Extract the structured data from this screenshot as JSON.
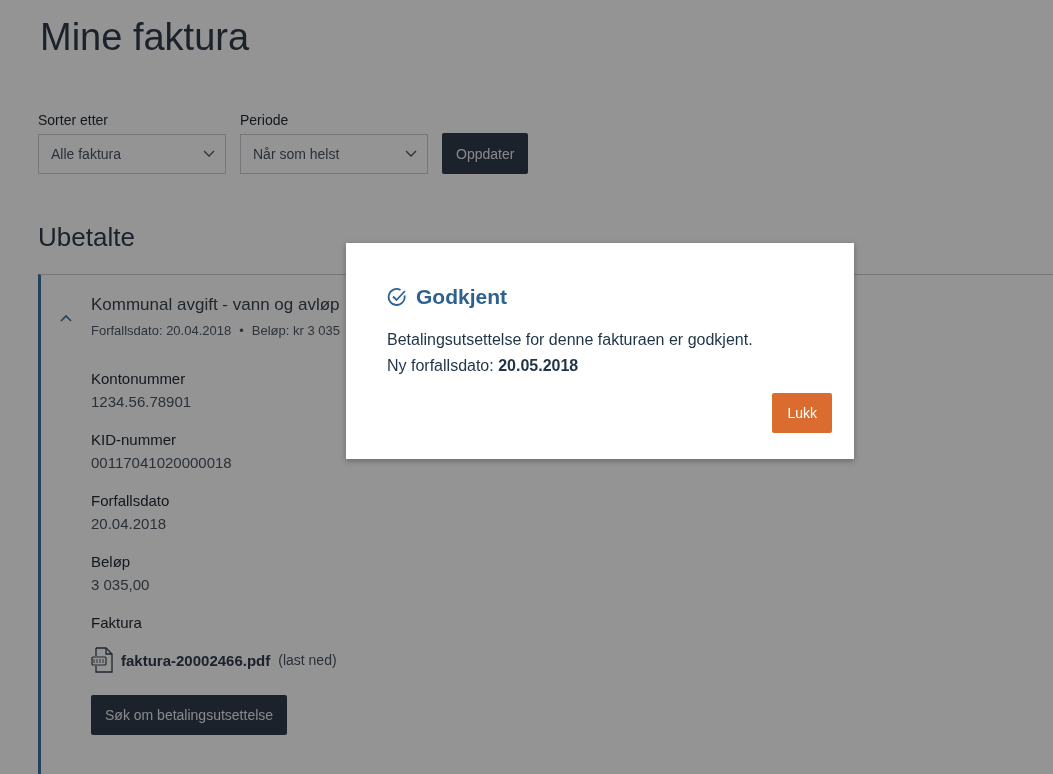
{
  "page_title": "Mine faktura",
  "filters": [
    {
      "label": "Sorter etter",
      "value": "Alle faktura"
    },
    {
      "label": "Periode",
      "value": "Når som helst"
    }
  ],
  "update_button": "Oppdater",
  "section_title": "Ubetalte",
  "invoice": {
    "expanded": true,
    "title": "Kommunal avgift - vann og avløp",
    "meta": [
      "Forfallsdato: 20.04.2018",
      "Beløp: kr 3 035"
    ],
    "separator": "•",
    "fields": [
      {
        "label": "Kontonummer",
        "value": "1234.56.78901"
      },
      {
        "label": "KID-nummer",
        "value": "00117041020000018"
      },
      {
        "label": "Forfallsdato",
        "value": "20.04.2018"
      },
      {
        "label": "Beløp",
        "value": "3 035,00"
      }
    ],
    "file_label": "Faktura",
    "file_name": "faktura-20002466.pdf",
    "file_link": "(last ned)",
    "action_button": "Søk om betalingsutsettelse"
  },
  "dialog": {
    "title": "Godkjent",
    "message": "Betalingsutsettelse for denne fakturaen er godkjent.",
    "detail": "Ny forfallsdato: **20.05.2018**",
    "close_button": "Lukk"
  }
}
